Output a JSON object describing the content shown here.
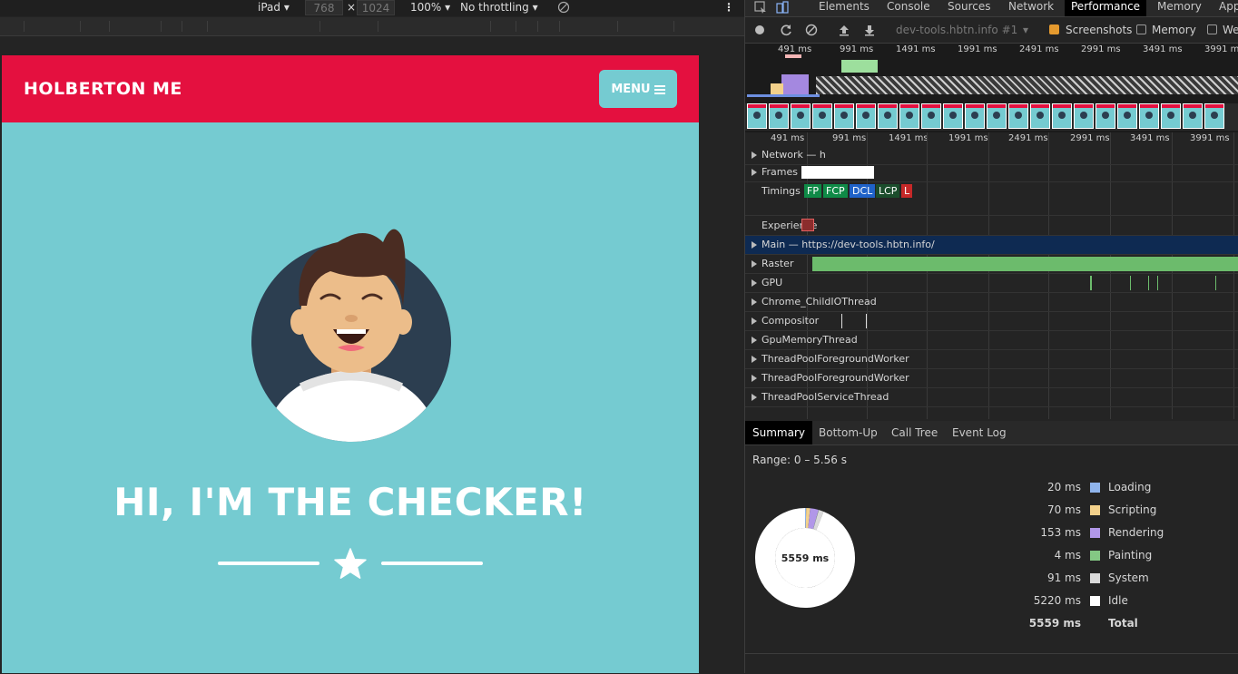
{
  "device_toolbar": {
    "device": "iPad ▾",
    "width": "768",
    "times": "×",
    "height": "1024",
    "zoom": "100% ▾",
    "throttle": "No throttling ▾"
  },
  "site": {
    "brand": "HOLBERTON ME",
    "menu_label": "MENU",
    "hero_title": "HI, I'M THE CHECKER!",
    "colors": {
      "nav": "#e4103f",
      "bg": "#75cbd1"
    }
  },
  "devtools": {
    "tabs": [
      "Elements",
      "Console",
      "Sources",
      "Network",
      "Performance",
      "Memory",
      "App"
    ],
    "active_tab": "Performance",
    "recording_name": "dev-tools.hbtn.info #1",
    "screenshots_label": "Screenshots",
    "memory_label": "Memory",
    "web_label": "Wel",
    "ticks": [
      "491 ms",
      "991 ms",
      "1491 ms",
      "1991 ms",
      "2491 ms",
      "2991 ms",
      "3491 ms",
      "3991 ms"
    ],
    "tracks": [
      {
        "label": "Network — h"
      },
      {
        "label": "Frames"
      },
      {
        "label": "Timings"
      },
      {
        "label": "Experience"
      },
      {
        "label": "Main — https://dev-tools.hbtn.info/"
      },
      {
        "label": "Raster"
      },
      {
        "label": "GPU"
      },
      {
        "label": "Chrome_ChildIOThread"
      },
      {
        "label": "Compositor"
      },
      {
        "label": "GpuMemoryThread"
      },
      {
        "label": "ThreadPoolForegroundWorker"
      },
      {
        "label": "ThreadPoolForegroundWorker"
      },
      {
        "label": "ThreadPoolServiceThread"
      }
    ],
    "timing_badges": [
      {
        "label": "FP",
        "color": "#0f8a47"
      },
      {
        "label": "FCP",
        "color": "#0f8a47"
      },
      {
        "label": "DCL",
        "color": "#1f62c8"
      },
      {
        "label": "LCP",
        "color": "#1b4d2c"
      },
      {
        "label": "L",
        "color": "#c62828"
      }
    ],
    "summary_tabs": [
      "Summary",
      "Bottom-Up",
      "Call Tree",
      "Event Log"
    ],
    "range": "Range: 0 – 5.56 s",
    "donut_total": "5559 ms",
    "summary": [
      {
        "value": "20 ms",
        "name": "Loading",
        "color": "#8fb4ec"
      },
      {
        "value": "70 ms",
        "name": "Scripting",
        "color": "#f3d18b"
      },
      {
        "value": "153 ms",
        "name": "Rendering",
        "color": "#b197e8"
      },
      {
        "value": "4 ms",
        "name": "Painting",
        "color": "#84c884"
      },
      {
        "value": "91 ms",
        "name": "System",
        "color": "#dadada"
      },
      {
        "value": "5220 ms",
        "name": "Idle",
        "color": "#ffffff"
      }
    ],
    "total_value": "5559 ms",
    "total_label": "Total"
  }
}
